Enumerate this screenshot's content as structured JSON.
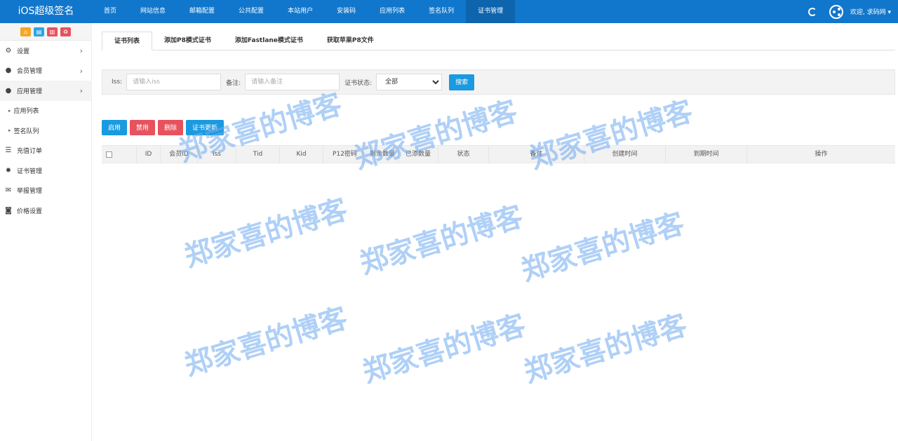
{
  "brand": "iOS超级签名",
  "top_nav": [
    "首页",
    "网站信息",
    "邮箱配置",
    "公共配置",
    "本站用户",
    "安装码",
    "应用列表",
    "签名队列",
    "证书管理"
  ],
  "top_nav_active_index": 8,
  "user_welcome": "欢迎, 求码网",
  "quick_buttons": [
    {
      "icon": "home-icon",
      "glyph": "⌂",
      "color": "#f5a623"
    },
    {
      "icon": "file-icon",
      "glyph": "▤",
      "color": "#2fa4e7"
    },
    {
      "icon": "trash-icon",
      "glyph": "▥",
      "color": "#e8525d"
    },
    {
      "icon": "recycle-icon",
      "glyph": "♻",
      "color": "#e8525d"
    }
  ],
  "sidebar": {
    "items": [
      {
        "label": "设置",
        "icon": "gears-icon",
        "glyph": "⚙",
        "chevron": true
      },
      {
        "label": "会员管理",
        "icon": "user-icon",
        "glyph": "●",
        "chevron": true
      },
      {
        "label": "应用管理",
        "icon": "apple-icon",
        "glyph": "●",
        "chevron": true,
        "expanded": true
      },
      {
        "label": "应用列表",
        "sub": true
      },
      {
        "label": "签名队列",
        "sub": true
      },
      {
        "label": "充值订单",
        "icon": "list-icon",
        "glyph": "☰"
      },
      {
        "label": "证书管理",
        "icon": "cert-icon",
        "glyph": "✹"
      },
      {
        "label": "举报管理",
        "icon": "envelope-icon",
        "glyph": "✉"
      },
      {
        "label": "价格设置",
        "icon": "money-icon",
        "glyph": "◙"
      }
    ]
  },
  "tabs": [
    "证书列表",
    "添加P8模式证书",
    "添加Fastlane模式证书",
    "获取苹果P8文件"
  ],
  "tabs_active_index": 0,
  "search": {
    "iss_label": "Iss:",
    "iss_placeholder": "请输入iss",
    "note_label": "备注:",
    "note_placeholder": "请输入备注",
    "status_label": "证书状态:",
    "status_value": "全部",
    "search_button": "搜索"
  },
  "actions": {
    "enable": "启用",
    "disable": "禁用",
    "delete": "删除",
    "update": "证书更新"
  },
  "table": {
    "headers": [
      "",
      "ID",
      "会员ID",
      "Iss",
      "Tid",
      "Kid",
      "P12密码",
      "剩余数量",
      "已添数量",
      "状态",
      "备注",
      "创建时间",
      "到期时间",
      "操作"
    ]
  },
  "watermark_text": "郑家喜的博客"
}
